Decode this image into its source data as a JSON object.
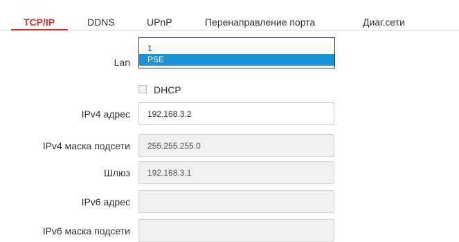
{
  "tabs": [
    {
      "label": "TCP/IP"
    },
    {
      "label": "DDNS"
    },
    {
      "label": "UPnP"
    },
    {
      "label": "Перенаправление порта"
    },
    {
      "label": "Диаг.сети"
    }
  ],
  "active_tab": "TCP/IP",
  "colors": {
    "accent": "#d4312a",
    "selection": "#1e90d6"
  },
  "form": {
    "lan": {
      "label": "Lan",
      "options": [
        "1",
        "PSE"
      ],
      "selected": "PSE"
    },
    "dhcp": {
      "label": "DHCP",
      "checked": false
    },
    "ipv4_address": {
      "label": "IPv4 адрес",
      "value": "192.168.3.2"
    },
    "ipv4_mask": {
      "label": "IPv4 маска подсети",
      "value": "255.255.255.0"
    },
    "gateway": {
      "label": "Шлюз",
      "value": "192.168.3.1"
    },
    "ipv6_address": {
      "label": "IPv6 адрес",
      "value": ""
    },
    "ipv6_mask": {
      "label": "IPv6 маска подсети",
      "value": ""
    }
  }
}
